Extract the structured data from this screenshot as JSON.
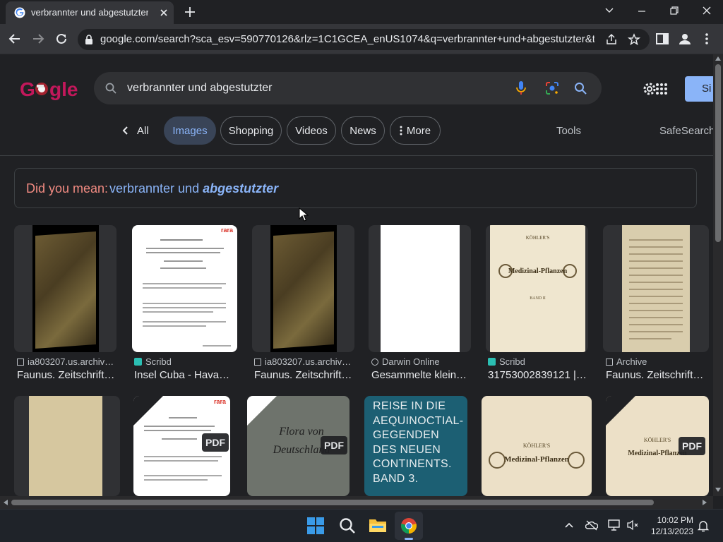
{
  "browser": {
    "tab_title": "verbrannter und abgestutzter - Google Search",
    "url": "google.com/search?sca_esv=590770126&rlz=1C1GCEA_enUS1074&q=verbrannter+und+abgestutzter&tbm=isc..."
  },
  "search": {
    "query": "verbrannter und abgestutzter",
    "sign_in": "Si"
  },
  "filters": {
    "back": "All",
    "items": [
      "Images",
      "Shopping",
      "Videos",
      "News",
      "More"
    ],
    "tools": "Tools",
    "safesearch": "SafeSearch"
  },
  "did_you_mean": {
    "prefix": "Did you mean:",
    "plain": "verbrannter und",
    "bold": "abgestutzter"
  },
  "results_row1": [
    {
      "source": "ia803207.us.archive...",
      "title": "Faunus. Zeitschrift ...",
      "source_icon": "archive-icon"
    },
    {
      "source": "Scribd",
      "title": "Insel Cuba - Havann...",
      "source_icon": "scribd-icon"
    },
    {
      "source": "ia803207.us.archive...",
      "title": "Faunus. Zeitschrift ...",
      "source_icon": "archive-icon"
    },
    {
      "source": "Darwin Online",
      "title": "Gesammelte kleiner...",
      "source_icon": "globe-icon"
    },
    {
      "source": "Scribd",
      "title": "31753002839121 | ...",
      "source_icon": "scribd-icon"
    },
    {
      "source": "Archive",
      "title": "Faunus. Zeitschrift f...",
      "source_icon": "archive-icon"
    }
  ],
  "results_row2": {
    "pdf_label": "PDF",
    "teal_card_text": "REISE IN DIE AEQUINOCTIAL-GEGENDEN DES NEUEN CONTINENTS. BAND 3.",
    "kohler_title": "KÖHLER'S",
    "kohler_sub": "Medizinal-Pflanzen",
    "flora_title": "Flora von Deutschland",
    "rara": "rara"
  },
  "book_cover": {
    "title": "KÖHLER'S",
    "sub": "Medizinal-Pflanzen",
    "band": "BAND II"
  },
  "taskbar": {
    "time": "10:02 PM",
    "date": "12/13/2023"
  },
  "colors": {
    "bg": "#202124",
    "accent_blue": "#8ab4f8",
    "did_you_mean_red": "#f28b82",
    "signin_blue": "#8ab4f8"
  }
}
